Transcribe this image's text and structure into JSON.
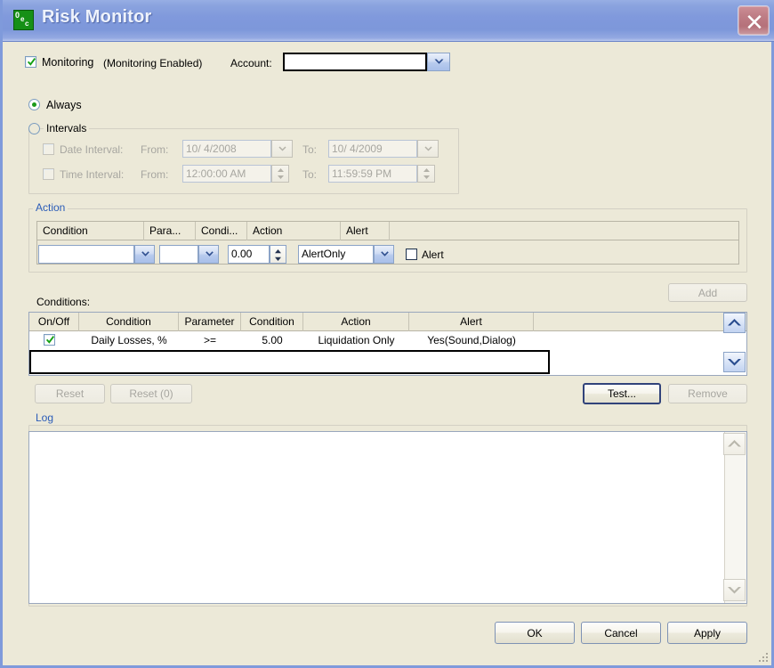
{
  "window": {
    "title": "Risk Monitor",
    "icon": "app-icon-oec",
    "icon_glyphs": [
      "0",
      "e",
      "c"
    ],
    "close_label": "Close",
    "accent_title_bg": "#8099dc",
    "accent_close_bg": "#bb767f",
    "dialog_bg": "#ece9d8",
    "group_label_color": "#2b5cb8"
  },
  "monitoring": {
    "checkbox_label": "Monitoring",
    "checked": true,
    "status_text": "(Monitoring Enabled)",
    "account_label": "Account:",
    "account_value": "",
    "account_placeholder": ""
  },
  "schedule": {
    "always_label": "Always",
    "always_selected": true,
    "intervals_label": "Intervals",
    "intervals_selected": false,
    "date_interval_label": "Date Interval:",
    "date_from_label": "From:",
    "date_from_value": "10/  4/2008",
    "date_to_label": "To:",
    "date_to_value": "10/  4/2009",
    "time_interval_label": "Time Interval:",
    "time_from_label": "From:",
    "time_from_value": "12:00:00 AM",
    "time_to_label": "To:",
    "time_to_value": "11:59:59 PM",
    "disabled": true
  },
  "action": {
    "group_label": "Action",
    "columns": [
      "Condition",
      "Para...",
      "Condi...",
      "Action",
      "Alert"
    ],
    "condition_value": "",
    "parameter_value": "",
    "number_value": "0.00",
    "action_value": "AlertOnly",
    "alert_checkbox_label": "Alert",
    "alert_checked": false,
    "add_label": "Add",
    "add_enabled": false
  },
  "conditions": {
    "label": "Conditions:",
    "columns": [
      "On/Off",
      "Condition",
      "Parameter",
      "Condition",
      "Action",
      "Alert",
      ""
    ],
    "rows": [
      {
        "on": true,
        "condition": "Daily Losses, %",
        "parameter": ">=",
        "condition2": "5.00",
        "action": "Liquidation Only",
        "alert": "Yes(Sound,Dialog)",
        "extra": ""
      }
    ],
    "edit_row_value": "",
    "scroll_up": "scroll-up-icon",
    "scroll_down": "scroll-down-icon"
  },
  "buttons": {
    "reset_label": "Reset",
    "reset_enabled": false,
    "reset_count_label": "Reset (0)",
    "reset_count_enabled": false,
    "test_label": "Test...",
    "test_enabled": true,
    "remove_label": "Remove",
    "remove_enabled": false
  },
  "log": {
    "group_label": "Log",
    "content": "",
    "scroll_up": "scroll-up-icon",
    "scroll_down": "scroll-down-icon"
  },
  "footer": {
    "ok_label": "OK",
    "cancel_label": "Cancel",
    "apply_label": "Apply"
  }
}
